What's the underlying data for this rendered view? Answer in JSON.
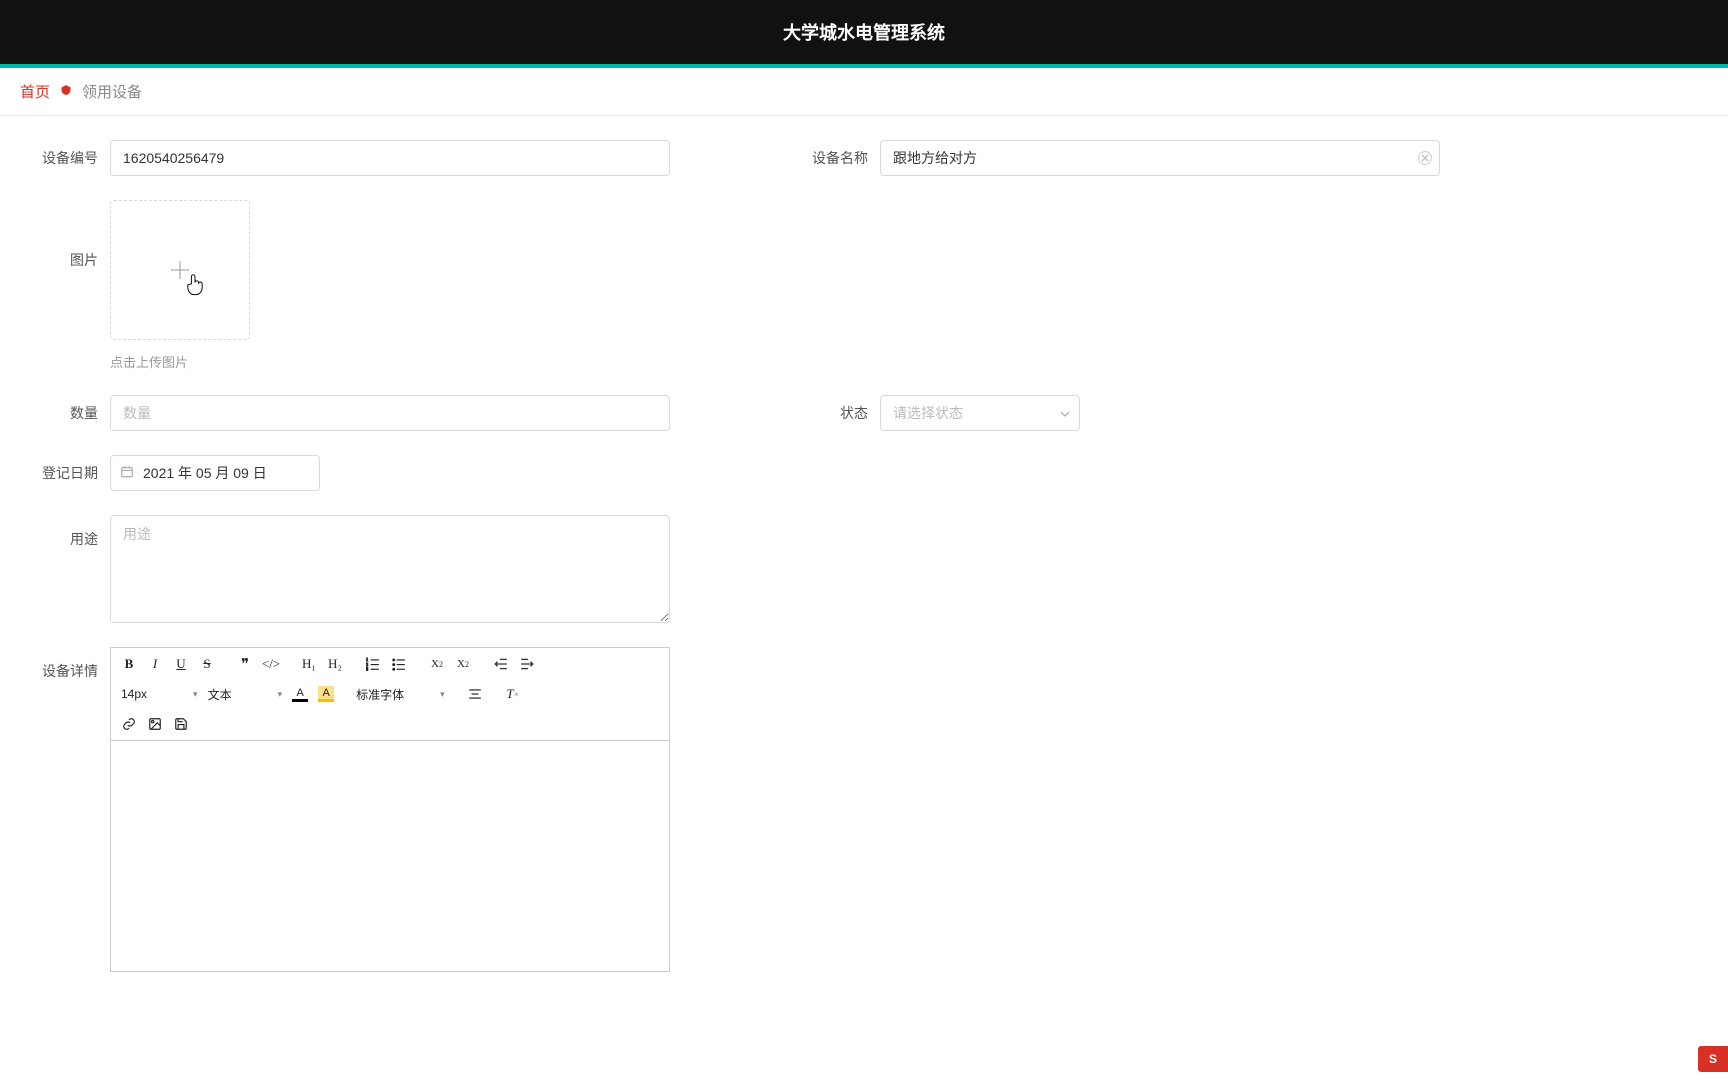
{
  "header": {
    "title": "大学城水电管理系统"
  },
  "breadcrumb": {
    "home": "首页",
    "current": "领用设备"
  },
  "form": {
    "labels": {
      "deviceId": "设备编号",
      "deviceName": "设备名称",
      "image": "图片",
      "quantity": "数量",
      "status": "状态",
      "regDate": "登记日期",
      "purpose": "用途",
      "detail": "设备详情"
    },
    "values": {
      "deviceId": "1620540256479",
      "deviceName": "跟地方给对方",
      "regDate": "2021 年 05 月 09 日"
    },
    "placeholders": {
      "quantity": "数量",
      "status": "请选择状态",
      "purpose": "用途"
    },
    "uploadHint": "点击上传图片"
  },
  "editor": {
    "fontSize": "14px",
    "style": "文本",
    "fontFamily": "标准字体"
  }
}
